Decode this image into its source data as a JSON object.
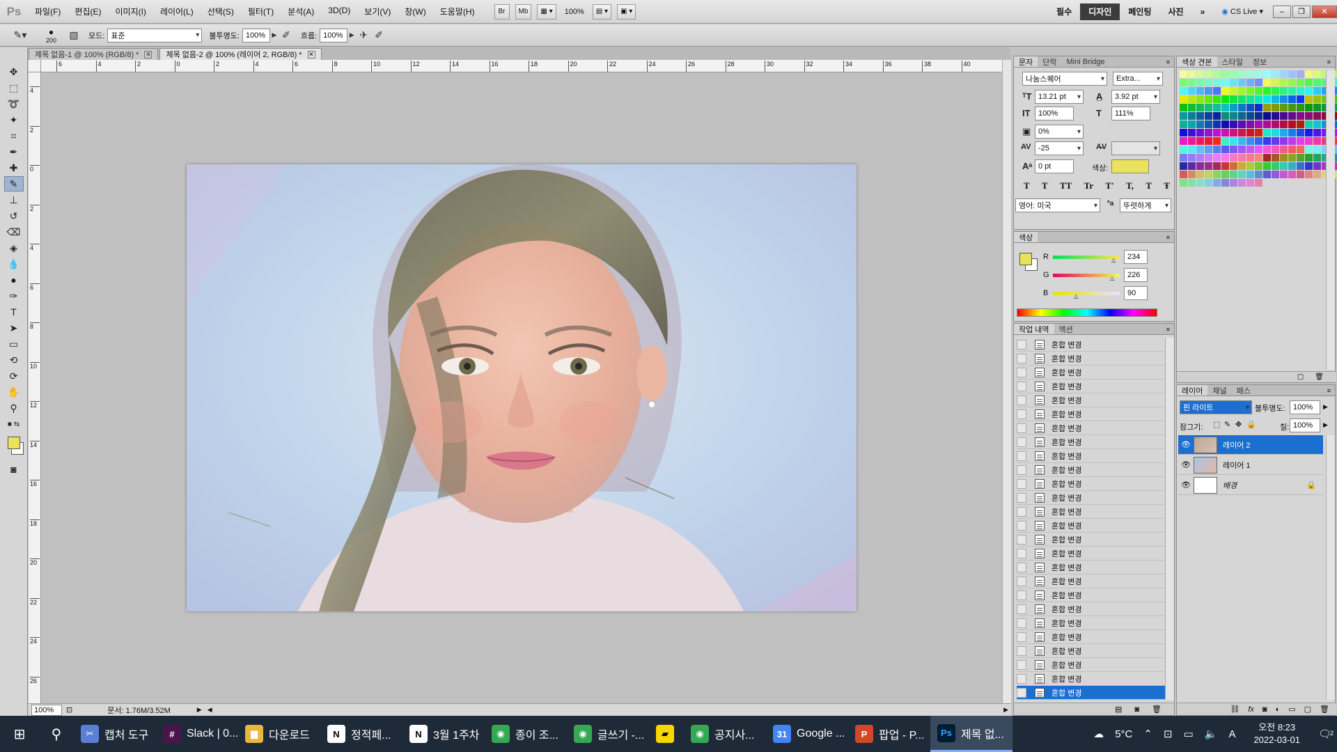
{
  "menubar": {
    "logo": "Ps",
    "items": [
      "파일(F)",
      "편집(E)",
      "이미지(I)",
      "레이어(L)",
      "선택(S)",
      "필터(T)",
      "분석(A)",
      "3D(D)",
      "보기(V)",
      "창(W)",
      "도움말(H)"
    ],
    "btn_br": "Br",
    "btn_mb": "Mb",
    "zoom": "100%",
    "workspaces": [
      "필수",
      "디자인",
      "페인팅",
      "사진"
    ],
    "active_workspace": "디자인",
    "cs_live": "CS Live"
  },
  "options": {
    "brush_size": "200",
    "mode_label": "모드:",
    "mode_value": "표준",
    "opacity_label": "불투명도:",
    "opacity_value": "100%",
    "flow_label": "흐름:",
    "flow_value": "100%"
  },
  "tabs": [
    {
      "label": "제목 없음-1 @ 100% (RGB/8) *",
      "active": false
    },
    {
      "label": "제목 없음-2 @ 100% (레이어 2, RGB/8) *",
      "active": true
    }
  ],
  "rulers": {
    "h": [
      "6",
      "4",
      "2",
      "0",
      "2",
      "4",
      "6",
      "8",
      "10",
      "12",
      "14",
      "16",
      "18",
      "20",
      "22",
      "24",
      "26",
      "28",
      "30",
      "32",
      "34",
      "36",
      "38",
      "40"
    ],
    "v": [
      "4",
      "2",
      "0",
      "2",
      "4",
      "6",
      "8",
      "10",
      "12",
      "14",
      "16",
      "18",
      "20",
      "22",
      "24",
      "26"
    ]
  },
  "status": {
    "zoom": "100%",
    "doc": "문서: 1.76M/3.52M"
  },
  "character_panel": {
    "tabs": [
      "문자",
      "단락",
      "Mini Bridge"
    ],
    "font_family": "나눔스퀘어",
    "font_style": "Extra...",
    "font_size": "13.21 pt",
    "leading": "3.92 pt",
    "v_scale": "100%",
    "h_scale": "111%",
    "tsume": "0%",
    "tracking": "-25",
    "kerning": "",
    "baseline": "0 pt",
    "color_label": "색상:",
    "style_buttons": [
      "T",
      "T",
      "TT",
      "Tr",
      "T'",
      "T,",
      "T",
      "Ŧ"
    ],
    "language": "영어: 미국",
    "aa_label": "ªa",
    "antialias": "뚜렷하게"
  },
  "color_panel": {
    "tab": "색상",
    "r_label": "R",
    "r": "234",
    "g_label": "G",
    "g": "226",
    "b_label": "B",
    "b": "90",
    "fg_color": "#eae25a"
  },
  "history_panel": {
    "tabs": [
      "작업 내역",
      "액션"
    ],
    "items": [
      "혼합 변경",
      "혼합 변경",
      "혼합 변경",
      "혼합 변경",
      "혼합 변경",
      "혼합 변경",
      "혼합 변경",
      "혼합 변경",
      "혼합 변경",
      "혼합 변경",
      "혼합 변경",
      "혼합 변경",
      "혼합 변경",
      "혼합 변경",
      "혼합 변경",
      "혼합 변경",
      "혼합 변경",
      "혼합 변경",
      "혼합 변경",
      "혼합 변경",
      "혼합 변경",
      "혼합 변경",
      "혼합 변경",
      "혼합 변경",
      "혼합 변경",
      "혼합 변경"
    ],
    "selected_index": 25
  },
  "swatches_panel": {
    "tabs": [
      "색상 견본",
      "스타일",
      "정보"
    ]
  },
  "layers_panel": {
    "tabs": [
      "레이어",
      "채널",
      "패스"
    ],
    "blend_mode": "핀 라이트",
    "opacity_label": "불투명도:",
    "opacity": "100%",
    "lock_label": "잠그기:",
    "fill_label": "칠:",
    "fill": "100%",
    "layers": [
      {
        "name": "레이어 2",
        "selected": true
      },
      {
        "name": "레이어 1",
        "selected": false
      },
      {
        "name": "배경",
        "selected": false
      }
    ]
  },
  "taskbar": {
    "apps": [
      {
        "label": "캡처 도구",
        "icon": "scissors-icon",
        "color": "#5b7fd6"
      },
      {
        "label": "Slack | 0...",
        "icon": "slack-icon",
        "color": "#4a154b"
      },
      {
        "label": "다운로드",
        "icon": "folder-icon",
        "color": "#e8b73c"
      },
      {
        "label": "정적페...",
        "icon": "notion-icon",
        "color": "#ffffff"
      },
      {
        "label": "3월 1주차",
        "icon": "notion-icon",
        "color": "#ffffff"
      },
      {
        "label": "종이 조...",
        "icon": "chrome-icon",
        "color": "#34a853"
      },
      {
        "label": "글쓰기 -...",
        "icon": "chrome-icon",
        "color": "#34a853"
      },
      {
        "label": "",
        "icon": "sticky-notes-icon",
        "color": "#f7d700"
      },
      {
        "label": "공지사...",
        "icon": "chrome-icon",
        "color": "#34a853"
      },
      {
        "label": "Google ...",
        "icon": "calendar-icon",
        "color": "#4285f4"
      },
      {
        "label": "팝업 - P...",
        "icon": "powerpoint-icon",
        "color": "#d24726"
      },
      {
        "label": "제목 없...",
        "icon": "photoshop-icon",
        "color": "#001d34"
      }
    ],
    "weather": "5°C",
    "ime": "A",
    "time": "오전 8:23",
    "date": "2022-03-01",
    "notifications": "2"
  }
}
